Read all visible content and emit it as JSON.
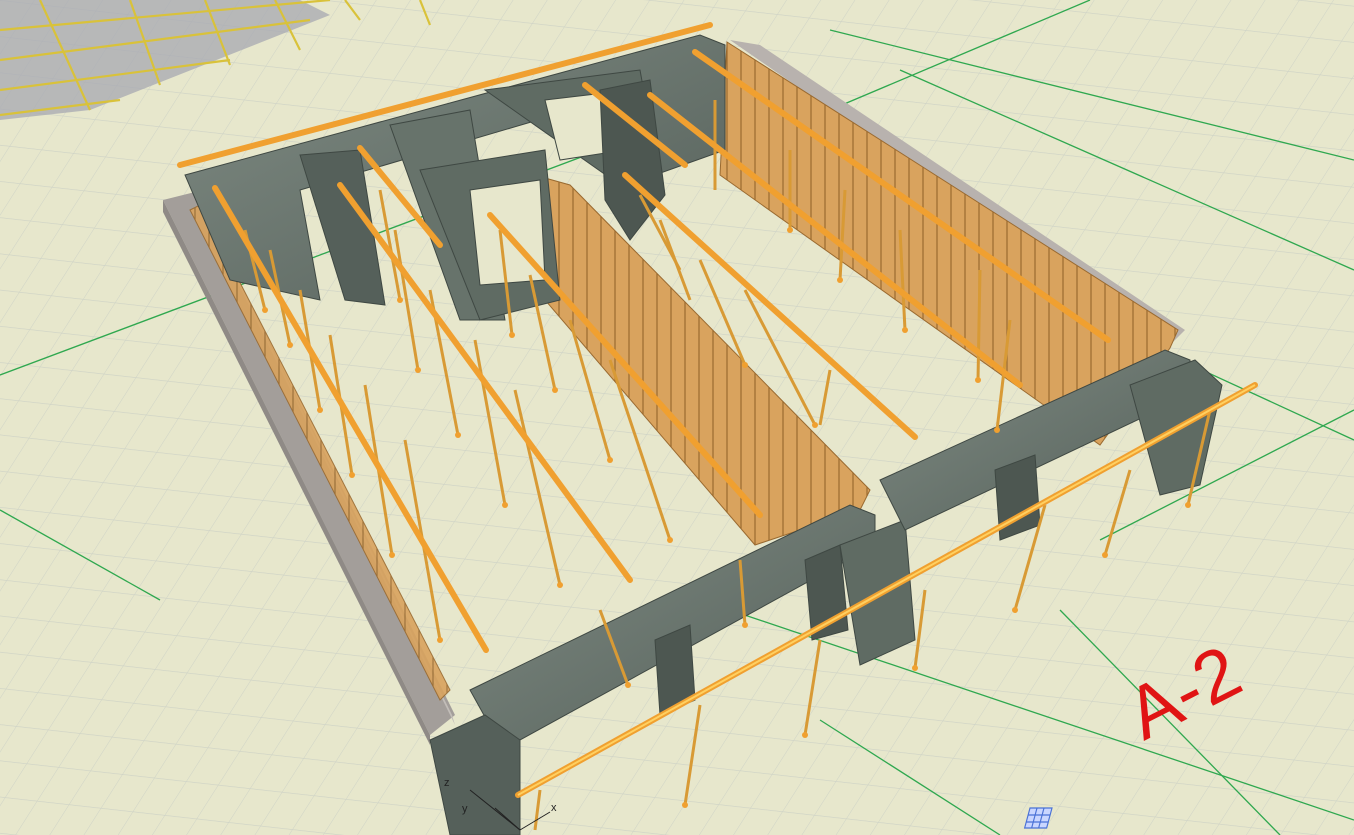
{
  "viewport": {
    "grid_label": "A-2",
    "axis_x_label": "x",
    "axis_y_label": "y",
    "axis_z_label": "z"
  },
  "colors": {
    "background": "#e7e7cc",
    "grid_minor": "#cfd3c6",
    "grid_major": "#2fa84f",
    "concrete": "#5f6b63",
    "concrete_light": "#7c8880",
    "formwork": "#d9a35e",
    "steel_prop": "#d89a35",
    "beam": "#f0a030",
    "masonry": "#a39e9a",
    "label_red": "#e01414"
  },
  "icons": [
    "grid-snap-icon",
    "axis-triad-icon"
  ]
}
